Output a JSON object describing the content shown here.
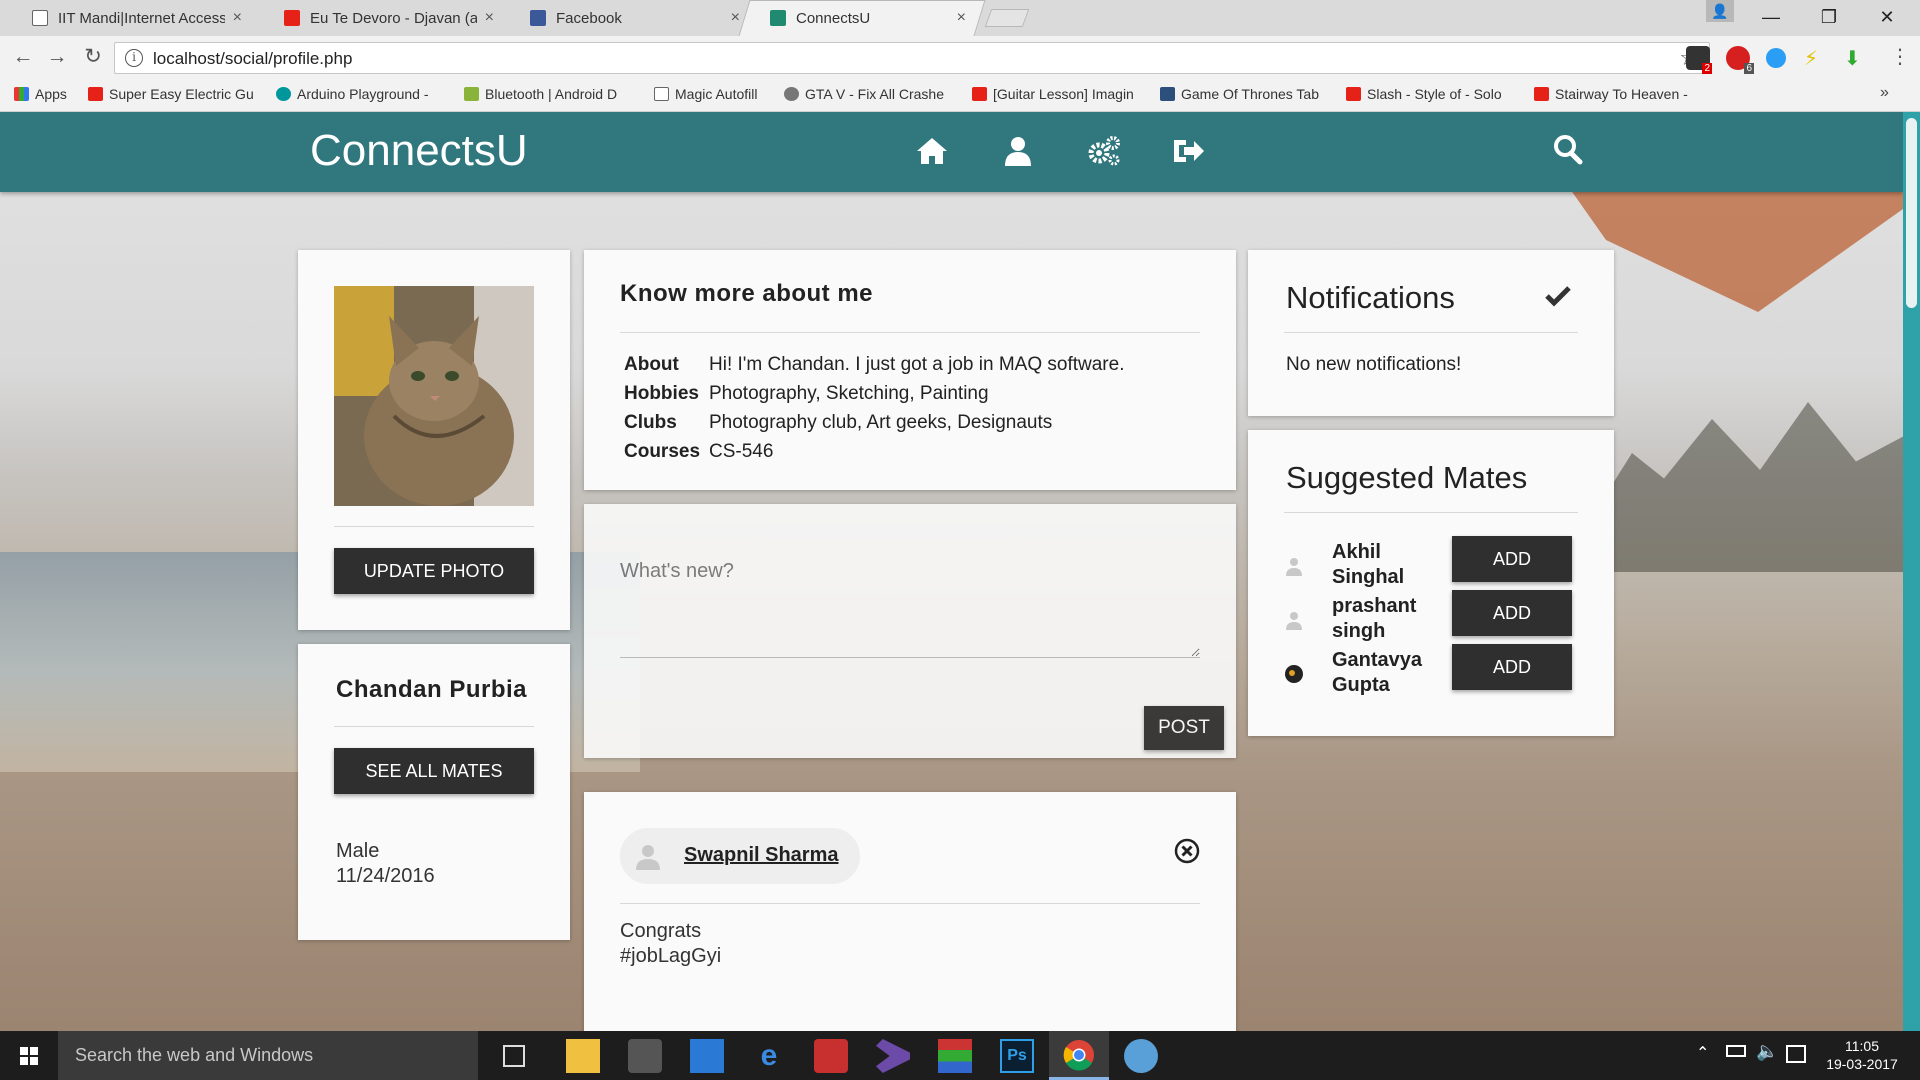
{
  "browser": {
    "tabs": [
      {
        "title": "IIT Mandi|Internet Access",
        "icon": "document-icon"
      },
      {
        "title": "Eu Te Devoro - Djavan (a",
        "icon": "youtube-icon"
      },
      {
        "title": "Facebook",
        "icon": "facebook-icon"
      },
      {
        "title": "ConnectsU",
        "icon": "connectsu-icon",
        "active": true
      }
    ],
    "close_glyph": "×",
    "window_controls": {
      "minimize": "—",
      "restore": "❐",
      "close": "✕"
    },
    "profile_glyph": "👤",
    "address": "localhost/social/profile.php",
    "info_glyph": "i",
    "star_glyph": "☆",
    "menu_glyph": "⋮",
    "extension_badges": [
      "2",
      "6"
    ],
    "bookmarks": [
      {
        "label": "Apps",
        "icon": "apps-grid-icon"
      },
      {
        "label": "Super Easy Electric Gu",
        "icon": "youtube-icon"
      },
      {
        "label": "Arduino Playground -",
        "icon": "arduino-icon"
      },
      {
        "label": "Bluetooth | Android D",
        "icon": "android-icon"
      },
      {
        "label": "Magic Autofill",
        "icon": "document-icon"
      },
      {
        "label": "GTA V - Fix All Crashe",
        "icon": "gta-icon"
      },
      {
        "label": "[Guitar Lesson] Imagin",
        "icon": "youtube-icon"
      },
      {
        "label": "Game Of Thrones Tab",
        "icon": "ultimate-guitar-icon"
      },
      {
        "label": "Slash - Style of - Solo",
        "icon": "youtube-icon"
      },
      {
        "label": "Stairway To Heaven -",
        "icon": "youtube-icon"
      }
    ],
    "bookmarks_overflow": "»"
  },
  "site": {
    "brand": "ConnectsU",
    "nav_icons": [
      "home-icon",
      "user-icon",
      "settings-icon",
      "logout-icon",
      "search-icon"
    ],
    "accent_color": "#31787e"
  },
  "profile": {
    "update_photo_label": "UPDATE PHOTO",
    "name": "Chandan Purbia",
    "see_all_mates_label": "SEE ALL MATES",
    "gender": "Male",
    "date": "11/24/2016"
  },
  "about": {
    "title": "Know more about me",
    "rows": [
      {
        "key": "About",
        "value": "Hi! I'm Chandan. I just got a job in MAQ software."
      },
      {
        "key": "Hobbies",
        "value": "Photography, Sketching, Painting"
      },
      {
        "key": "Clubs",
        "value": "Photography club, Art geeks, Designauts"
      },
      {
        "key": "Courses",
        "value": "CS-546"
      }
    ]
  },
  "composer": {
    "placeholder": "What's new?",
    "post_label": "POST"
  },
  "feed_post": {
    "author": "Swapnil Sharma",
    "text_line1": "Congrats",
    "text_line2": "#jobLagGyi"
  },
  "notifications": {
    "title": "Notifications",
    "empty_text": "No new notifications!"
  },
  "suggested": {
    "title": "Suggested Mates",
    "mates": [
      {
        "name": "Akhil Singhal",
        "add_label": "ADD"
      },
      {
        "name": "prashant singh",
        "add_label": "ADD"
      },
      {
        "name": "Gantavya Gupta",
        "add_label": "ADD"
      }
    ]
  },
  "taskbar": {
    "search_placeholder": "Search the web and Windows",
    "time": "11:05",
    "date": "19-03-2017"
  }
}
